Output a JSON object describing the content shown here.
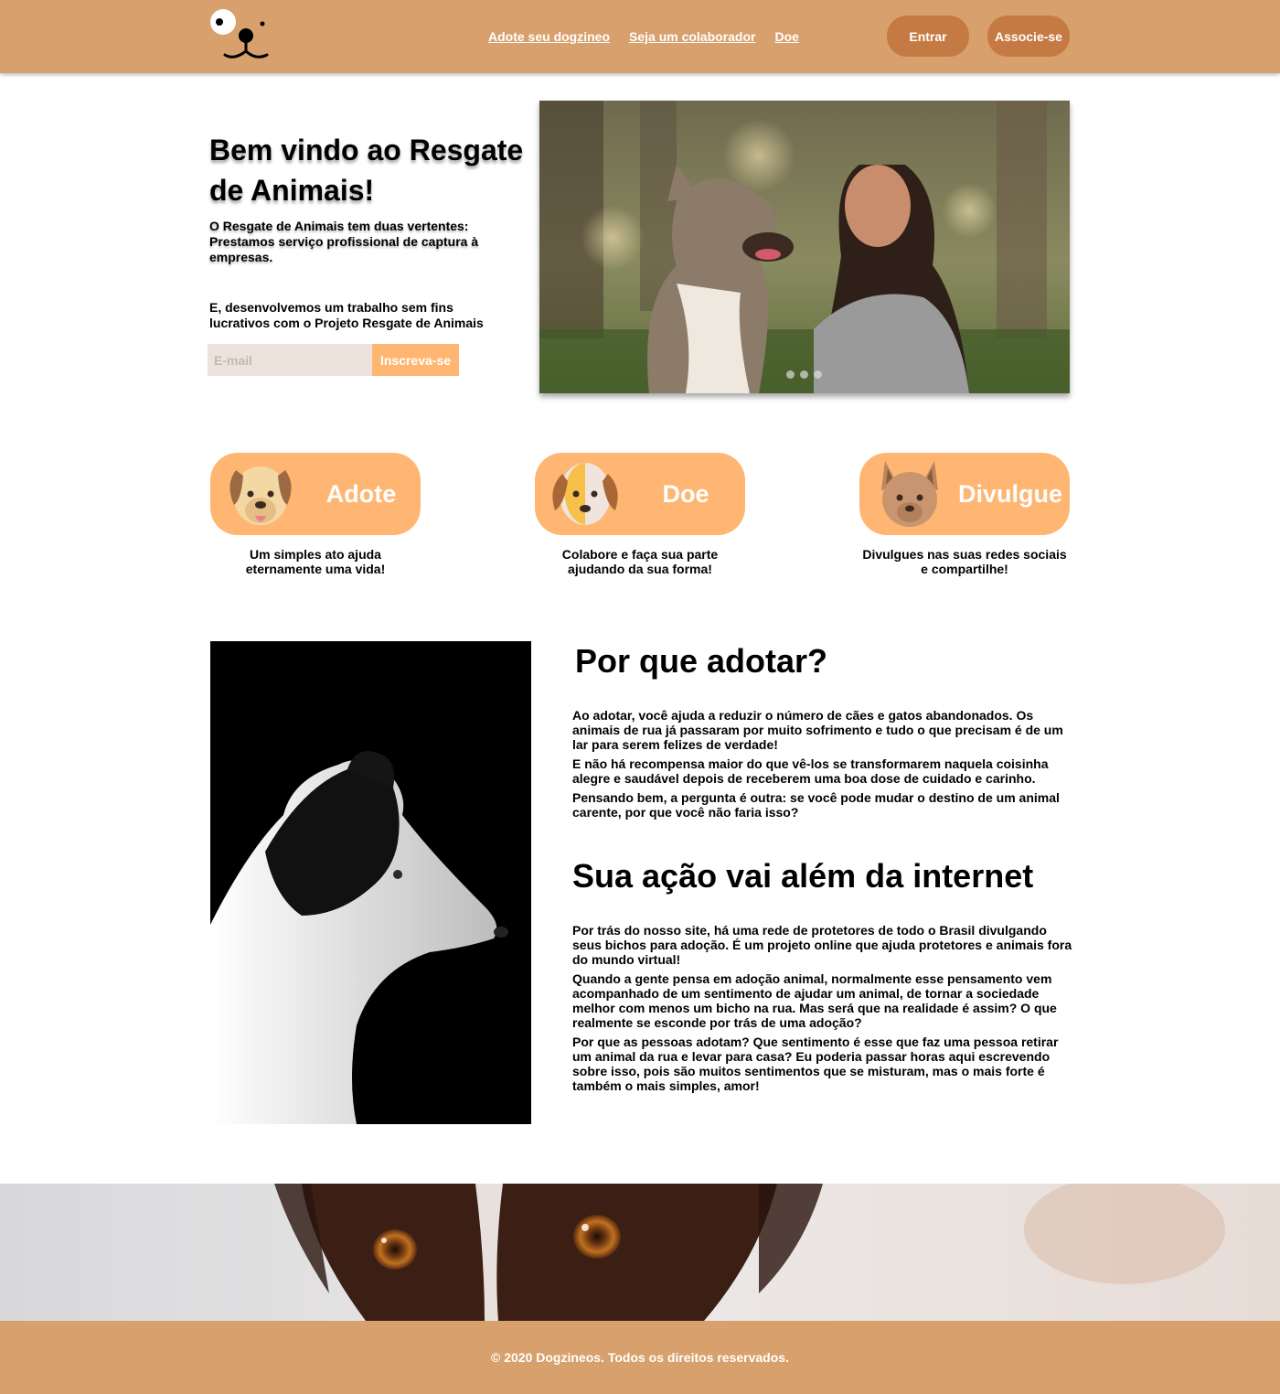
{
  "header": {
    "nav": [
      "Adote seu dogzineo",
      "Seja um colaborador",
      "Doe"
    ],
    "login_label": "Entrar",
    "signup_label": "Associe-se"
  },
  "hero": {
    "title": "Bem vindo ao Resgate de Animais!",
    "paragraph1": "O Resgate de Animais tem duas vertentes: Prestamos serviço profissional de captura à empresas.",
    "paragraph2": "E, desenvolvemos um trabalho sem fins lucrativos com o Projeto Resgate de Animais",
    "email_placeholder": "E-mail",
    "subscribe_label": "Inscreva-se"
  },
  "cards": [
    {
      "label": "Adote",
      "icon": "dog-face-icon",
      "description": "Um simples ato ajuda eternamente uma vida!"
    },
    {
      "label": "Doe",
      "icon": "spotted-dog-icon",
      "description": "Colabore e faça sua parte ajudando da sua forma!"
    },
    {
      "label": "Divulgue",
      "icon": "corgi-icon",
      "description": "Divulgues nas suas redes sociais e compartilhe!"
    }
  ],
  "why_adopt": {
    "title": "Por que adotar?",
    "paragraphs": [
      "Ao adotar, você ajuda a reduzir o número de cães e gatos abandonados. Os animais de rua já passaram por muito sofrimento e tudo o que precisam é de um lar para serem felizes de verdade!",
      "E não há recompensa maior do que vê-los se transformarem naquela coisinha alegre e saudável depois de receberem uma boa dose de cuidado e carinho.",
      "Pensando bem, a pergunta é outra: se você pode mudar o destino de um animal carente, por que você não faria isso?"
    ]
  },
  "beyond_internet": {
    "title": "Sua ação vai além da internet",
    "paragraphs": [
      "Por trás do nosso site, há uma rede de protetores de todo o Brasil divulgando seus bichos para adoção. É um projeto online que ajuda protetores e animais fora do mundo virtual!",
      "Quando a gente pensa em adoção animal, normalmente esse pensamento vem acompanhado de um sentimento de ajudar um animal, de tornar a sociedade melhor com menos um bicho na rua. Mas será que na realidade é assim? O que realmente se esconde por trás de uma adoção?",
      "Por que as pessoas adotam? Que sentimento é esse que faz uma pessoa retirar um animal da rua e levar para casa? Eu poderia passar horas aqui escrevendo sobre isso, pois são muitos sentimentos que se misturam, mas o mais forte é também o mais simples, amor!"
    ]
  },
  "footer": {
    "copyright": "© 2020 Dogzineos. Todos os direitos reservados."
  },
  "colors": {
    "header_bg": "#D7A06C",
    "button_bg": "#C67A43",
    "card_bg": "#FFB673",
    "input_bg": "#EEE2DD"
  }
}
